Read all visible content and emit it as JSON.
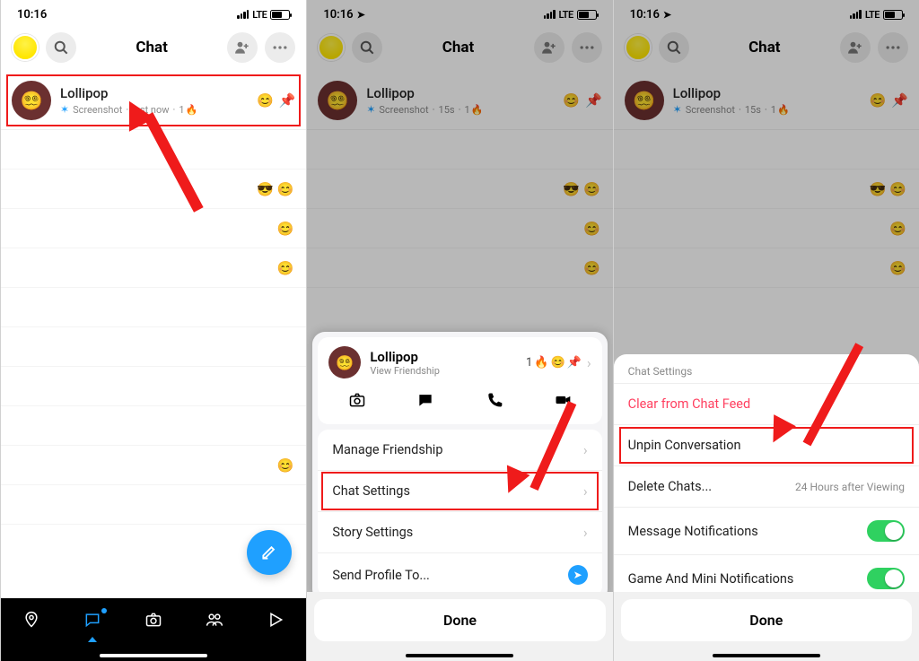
{
  "status": {
    "time": "10:16",
    "signal": "LTE"
  },
  "header": {
    "title": "Chat",
    "search": "search",
    "addFriend": "add",
    "more": "more"
  },
  "chat": {
    "name": "Lollipop",
    "status_screenshot": "Screenshot",
    "time_now": "just now",
    "time_15s": "15s",
    "streak_count": "1"
  },
  "panel2": {
    "viewFriendship": "View Friendship",
    "streak": "1",
    "rows": {
      "manage": "Manage Friendship",
      "chatSettings": "Chat Settings",
      "storySettings": "Story Settings",
      "sendProfile": "Send Profile To..."
    },
    "done": "Done"
  },
  "panel3": {
    "title": "Chat Settings",
    "clear": "Clear from Chat Feed",
    "unpin": "Unpin Conversation",
    "delete": "Delete Chats...",
    "deleteHint": "24 Hours after Viewing",
    "msgNotif": "Message Notifications",
    "gameNotif": "Game And Mini Notifications",
    "done": "Done"
  }
}
